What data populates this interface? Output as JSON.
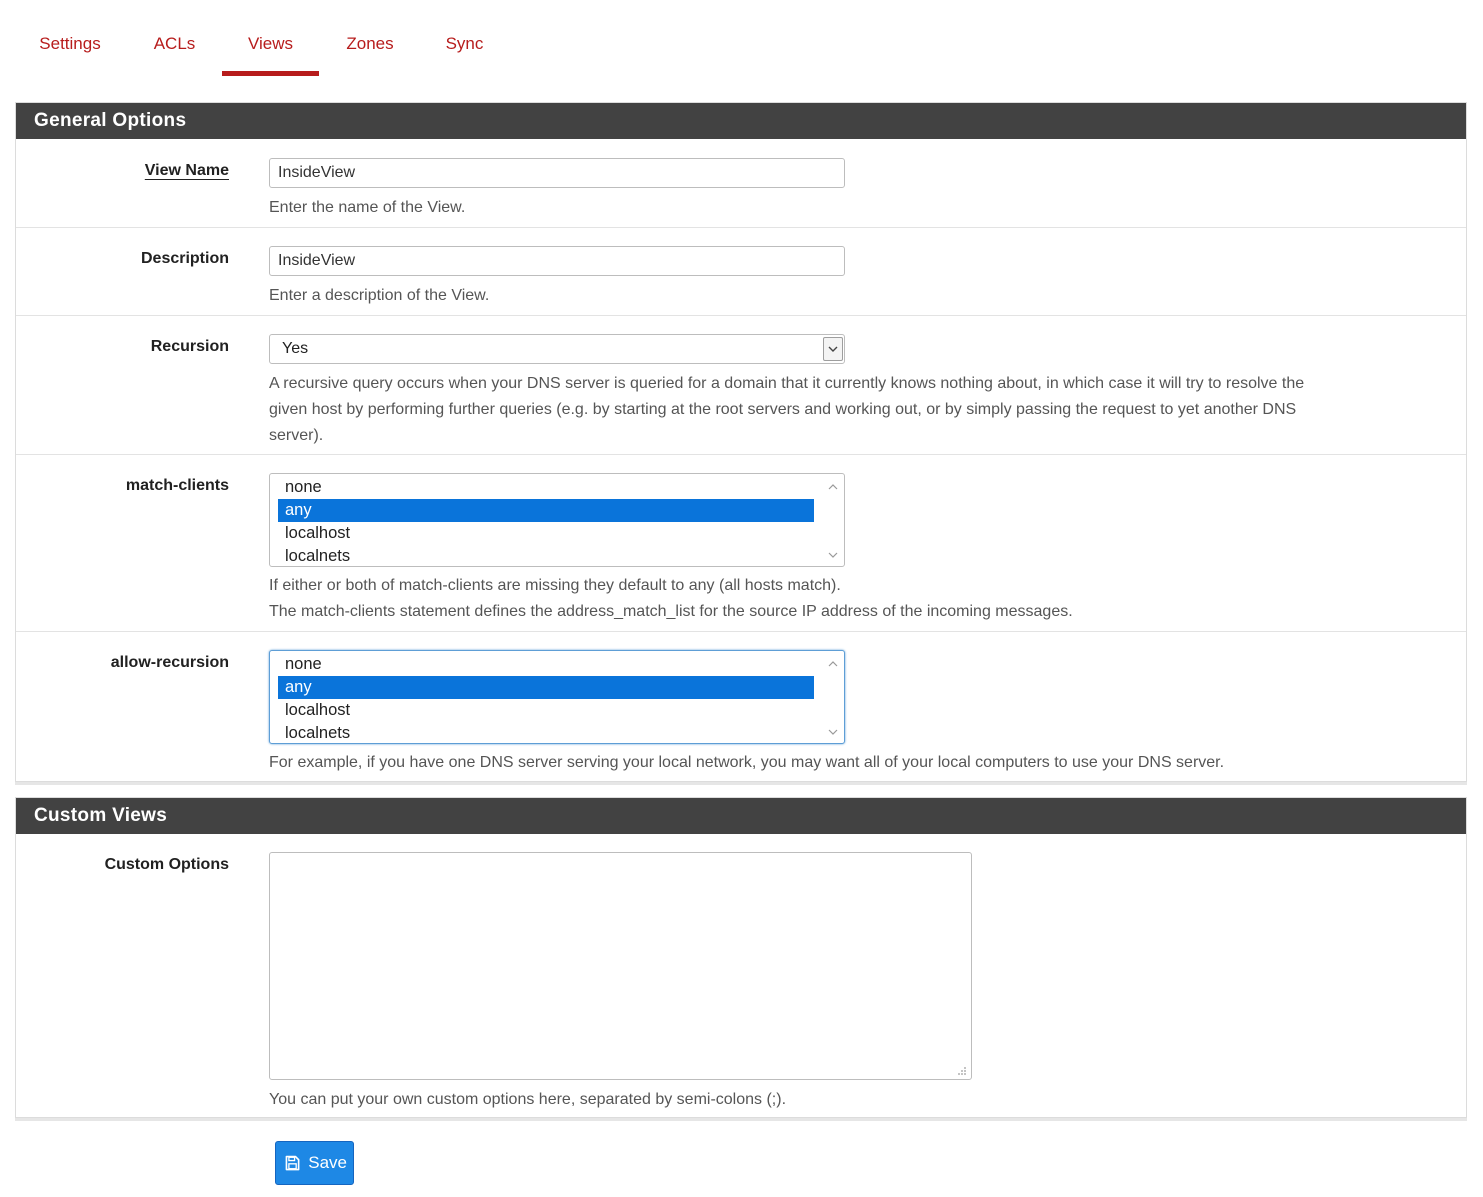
{
  "tabs": [
    {
      "label": "Settings",
      "active": false
    },
    {
      "label": "ACLs",
      "active": false
    },
    {
      "label": "Views",
      "active": true
    },
    {
      "label": "Zones",
      "active": false
    },
    {
      "label": "Sync",
      "active": false
    }
  ],
  "general": {
    "heading": "General Options",
    "view_name": {
      "label": "View Name",
      "value": "InsideView",
      "help": "Enter the name of the View."
    },
    "description": {
      "label": "Description",
      "value": "InsideView",
      "help": "Enter a description of the View."
    },
    "recursion": {
      "label": "Recursion",
      "value": "Yes",
      "help_line1": "A recursive query occurs when your DNS server is queried for a domain that it currently knows nothing about,  in which case it will try to resolve the",
      "help_line2": "given host by performing further queries  (e.g. by starting at the root servers and working out, or by simply passing the request to yet another DNS",
      "help_line3": "server)."
    },
    "match_clients": {
      "label": "match-clients",
      "options": [
        "none",
        "any",
        "localhost",
        "localnets"
      ],
      "selected": "any",
      "help_line1": "If either or both of match-clients are missing they default to any (all hosts match).",
      "help_line2": "The match-clients statement defines the address_match_list for the source IP address of the incoming messages."
    },
    "allow_recursion": {
      "label": "allow-recursion",
      "options": [
        "none",
        "any",
        "localhost",
        "localnets"
      ],
      "selected": "any",
      "help": "For example, if you have one DNS server serving your local network, you may want  all of your local computers to use your DNS server."
    }
  },
  "custom": {
    "heading": "Custom Views",
    "custom_options": {
      "label": "Custom Options",
      "value": "",
      "help": "You can put your own custom options here, separated by semi-colons (;)."
    }
  },
  "save_button": {
    "label": "Save",
    "icon": "floppy-disk-icon",
    "color": "#1e88e5"
  },
  "colors": {
    "accent": "#b71c1c",
    "panel_header": "#424242",
    "selection": "#0a74da"
  }
}
